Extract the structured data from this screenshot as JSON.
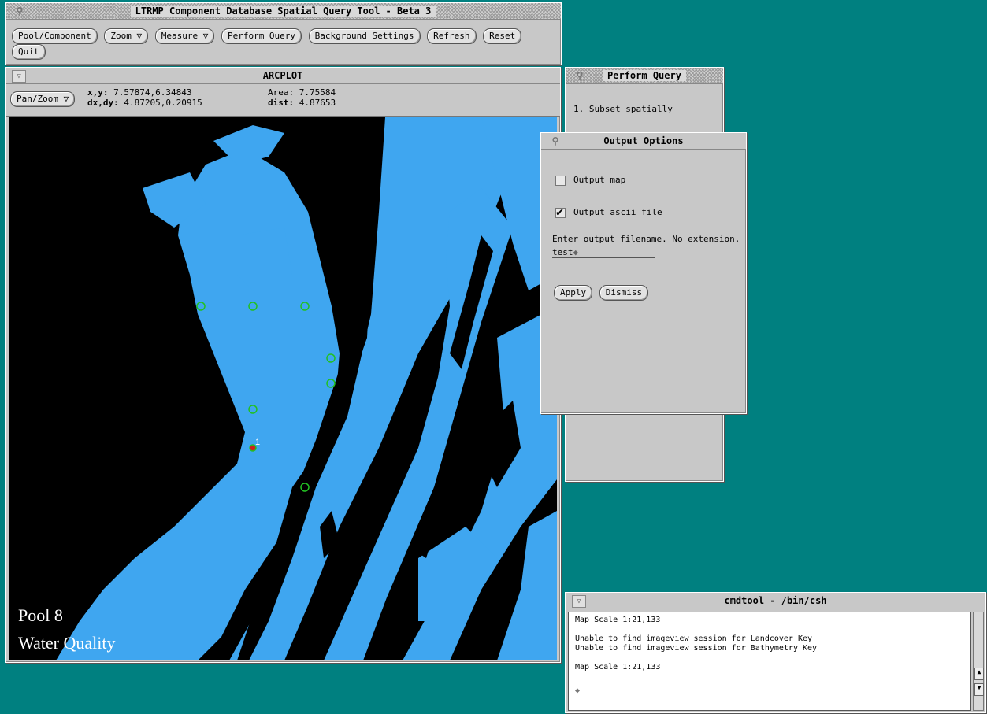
{
  "main_window": {
    "title": "LTRMP Component Database Spatial Query Tool - Beta 3",
    "buttons": [
      "Pool/Component",
      "Zoom ▽",
      "Measure ▽",
      "Perform Query",
      "Background Settings",
      "Refresh",
      "Reset",
      "Quit"
    ]
  },
  "arcplot": {
    "title": "ARCPLOT",
    "mode_button": "Pan/Zoom ▽",
    "xy_label": "x,y:",
    "xy_value": "7.57874,6.34843",
    "dxdy_label": "dx,dy:",
    "dxdy_value": "4.87205,0.20915",
    "area_label": "Area:",
    "area_value": "7.75584",
    "dist_label": "dist:",
    "dist_value": "4.87653",
    "map_caption_line1": "Pool 8",
    "map_caption_line2": "Water Quality",
    "sample_point_label": "1",
    "colors": {
      "water": "#3fa6f0",
      "land": "#000000",
      "sample_point": "#22c022",
      "selected_point": "#d02020"
    }
  },
  "perform_query": {
    "title": "Perform Query",
    "step1": "1. Subset spatially"
  },
  "output_options": {
    "title": "Output Options",
    "option_map_label": "Output map",
    "option_map_checked": false,
    "option_ascii_label": "Output ascii file",
    "option_ascii_checked": true,
    "filename_prompt": "Enter output filename. No extension.",
    "filename_value": "test",
    "apply_label": "Apply",
    "dismiss_label": "Dismiss"
  },
  "cmdtool": {
    "title": "cmdtool - /bin/csh",
    "lines": [
      "Map Scale 1:21,133",
      "",
      "Unable to find imageview session for Landcover Key",
      "Unable to find imageview session for Bathymetry Key",
      "",
      "Map Scale 1:21,133"
    ]
  }
}
